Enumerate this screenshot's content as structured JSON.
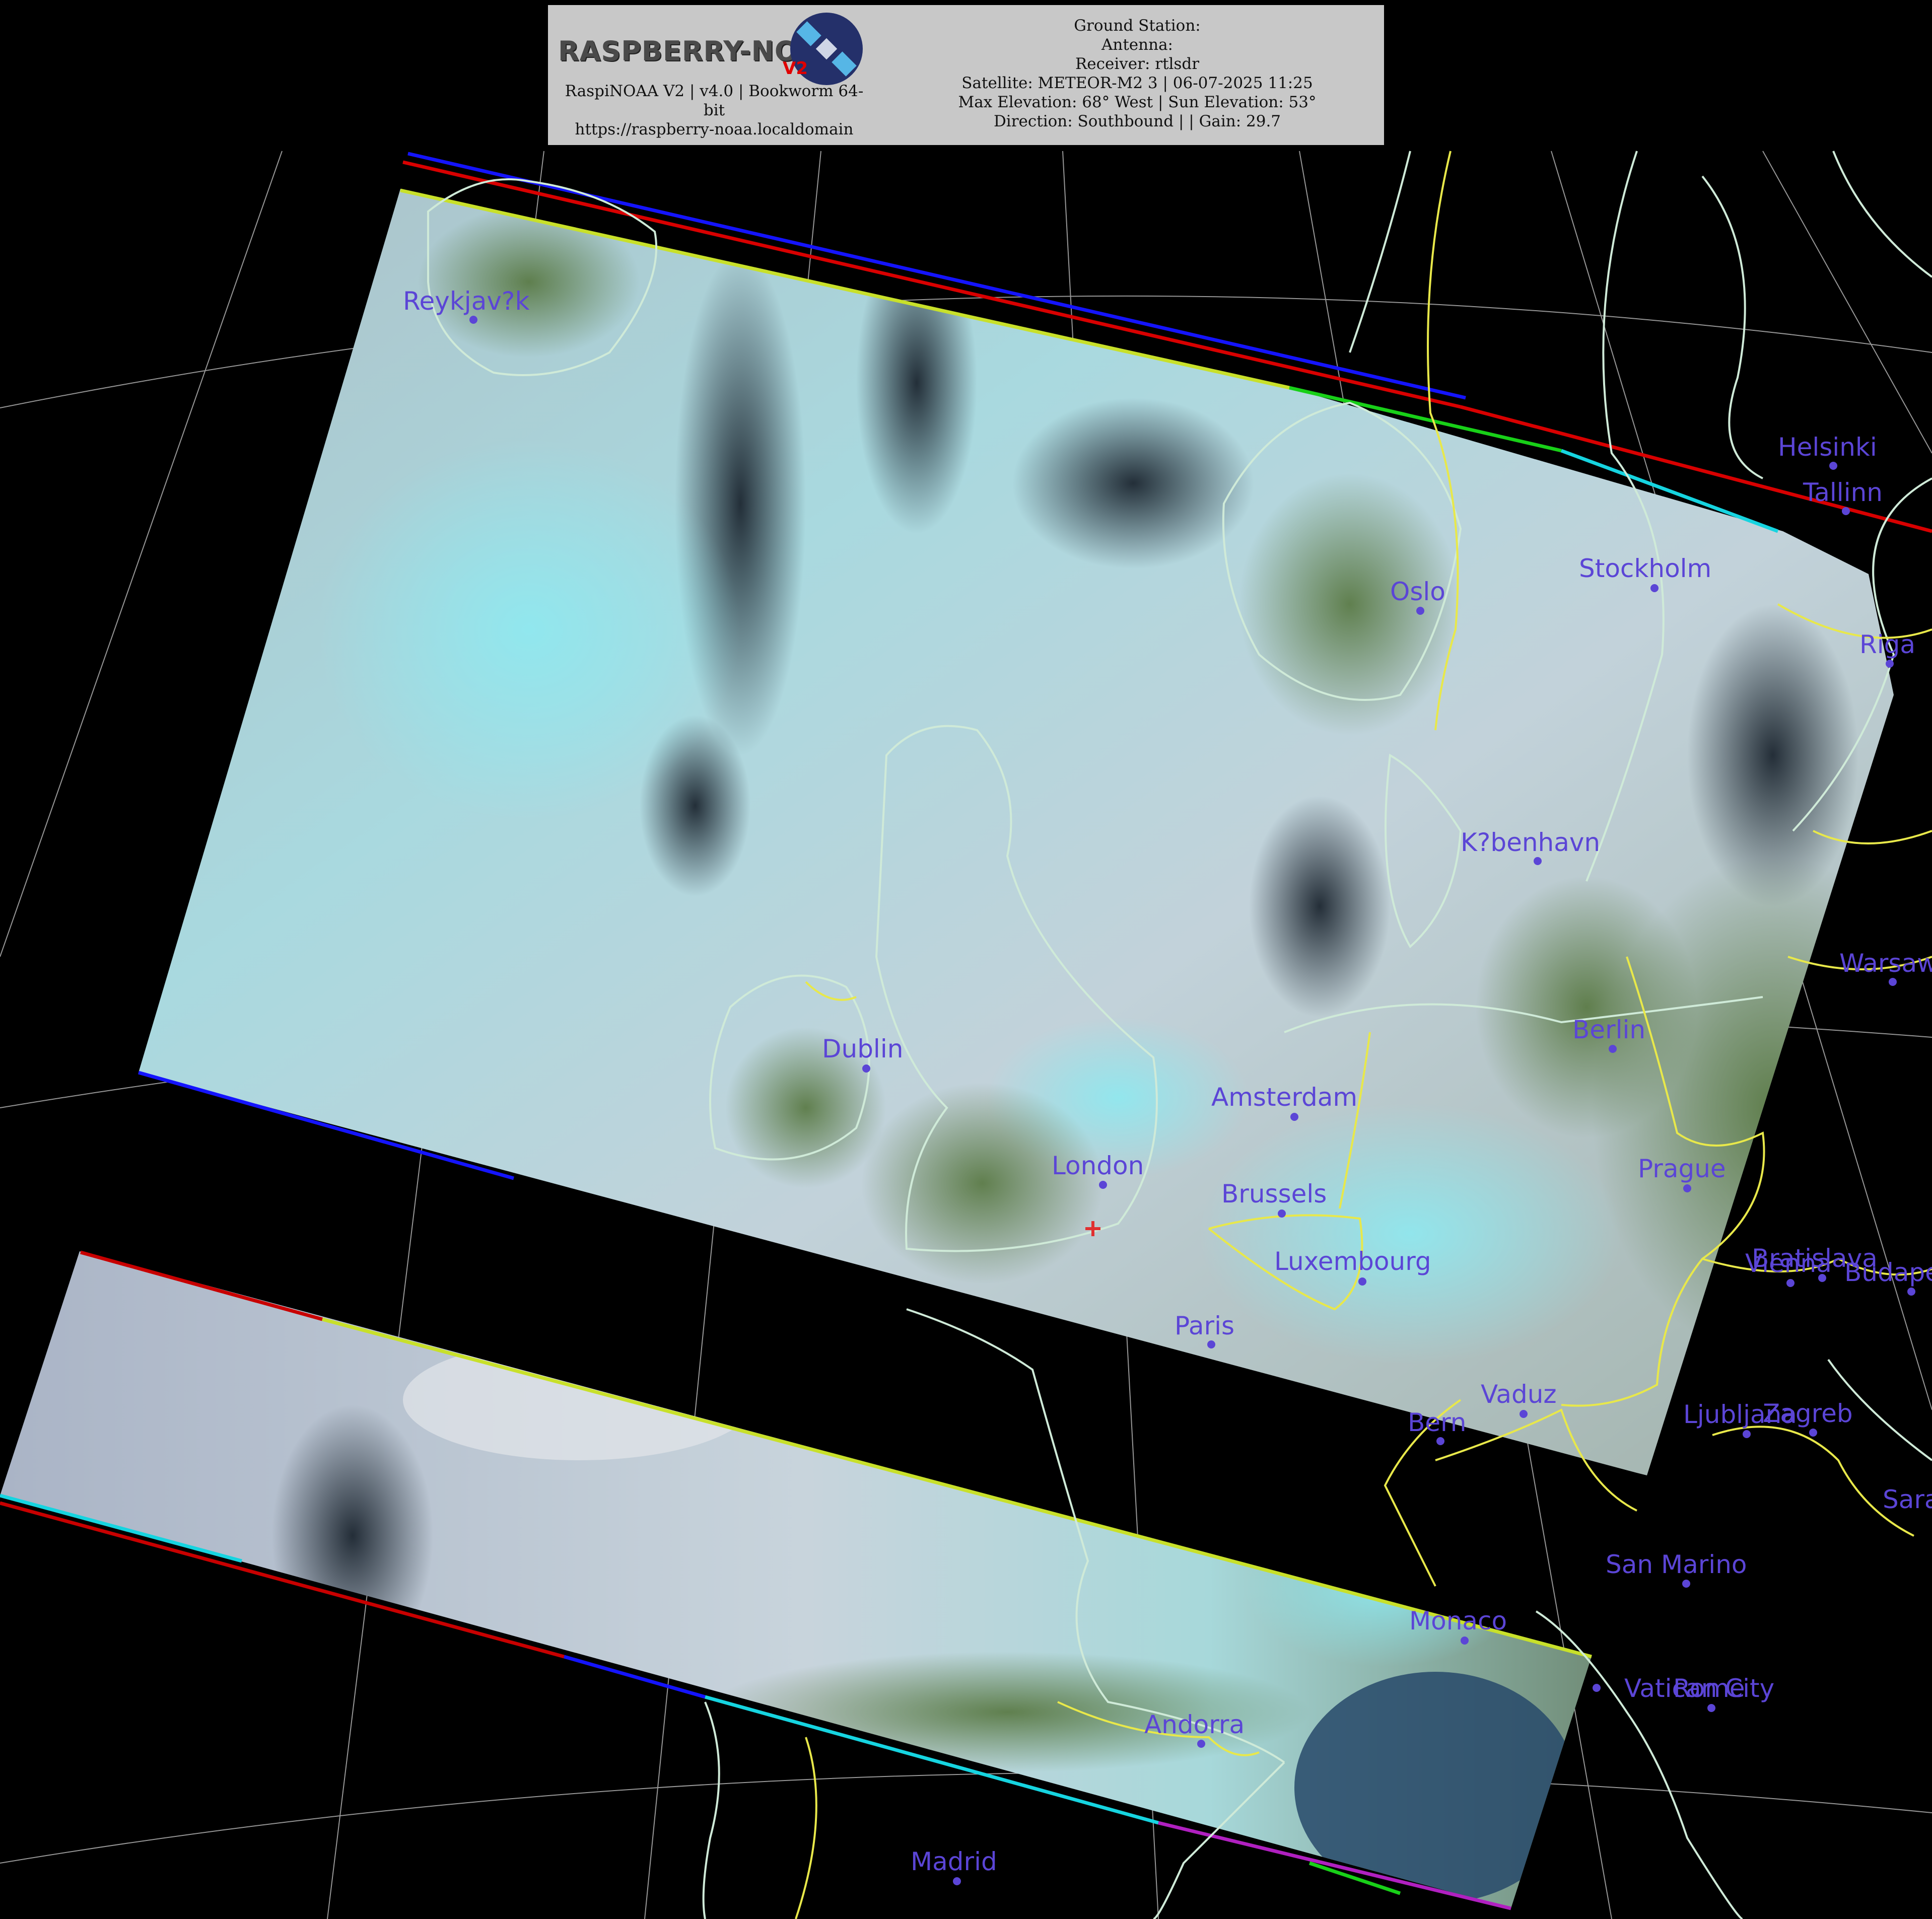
{
  "header": {
    "logo_text": "RASPBERRY-NOAA",
    "logo_badge": "V2",
    "app_line1": "RaspiNOAA V2 | v4.0 | Bookworm 64-",
    "app_line2": "bit",
    "url": "https://raspberry-noaa.localdomain",
    "ground_station": "Ground Station:",
    "antenna": "Antenna:",
    "receiver": "Receiver: rtlsdr",
    "satellite": "Satellite: METEOR-M2 3 | 06-07-2025 11:25",
    "elevation": "Max Elevation: 68° West | Sun Elevation: 53°",
    "direction": "Direction: Southbound | | Gain: 29.7"
  },
  "cities": {
    "reykjavik": "Reykjav?k",
    "helsinki": "Helsinki",
    "tallinn": "Tallinn",
    "stockholm": "Stockholm",
    "oslo": "Oslo",
    "riga": "Riga",
    "kobenhavn": "K?benhavn",
    "warsaw": "Warsaw",
    "berlin": "Berlin",
    "dublin": "Dublin",
    "amsterdam": "Amsterdam",
    "london": "London",
    "brussels": "Brussels",
    "prague": "Prague",
    "bratislava": "Bratislava",
    "vienna": "Vienna",
    "budapest": "Budapest",
    "luxembourg": "Luxembourg",
    "paris": "Paris",
    "vaduz": "Vaduz",
    "bern": "Bern",
    "ljubljana": "Ljubljana",
    "zagreb": "Zagreb",
    "sarajevo": "Sarajevo",
    "san_marino": "San Marino",
    "monaco": "Monaco",
    "vatican": "Vatican City",
    "rome": "Rome",
    "andorra": "Andorra",
    "madrid": "Madrid"
  },
  "colors": {
    "label": "#5b45d6",
    "coast": "#cfead8",
    "border": "#e8e84a",
    "graticule": "#d0d0d0",
    "cloud": "#b9cdd6",
    "cloud_cyan": "#8fe3ec",
    "land": "#5c7a45",
    "sea": "#1f2a34"
  },
  "icons": {
    "logo": "satellite-icon",
    "marker": "station-cross-icon"
  }
}
